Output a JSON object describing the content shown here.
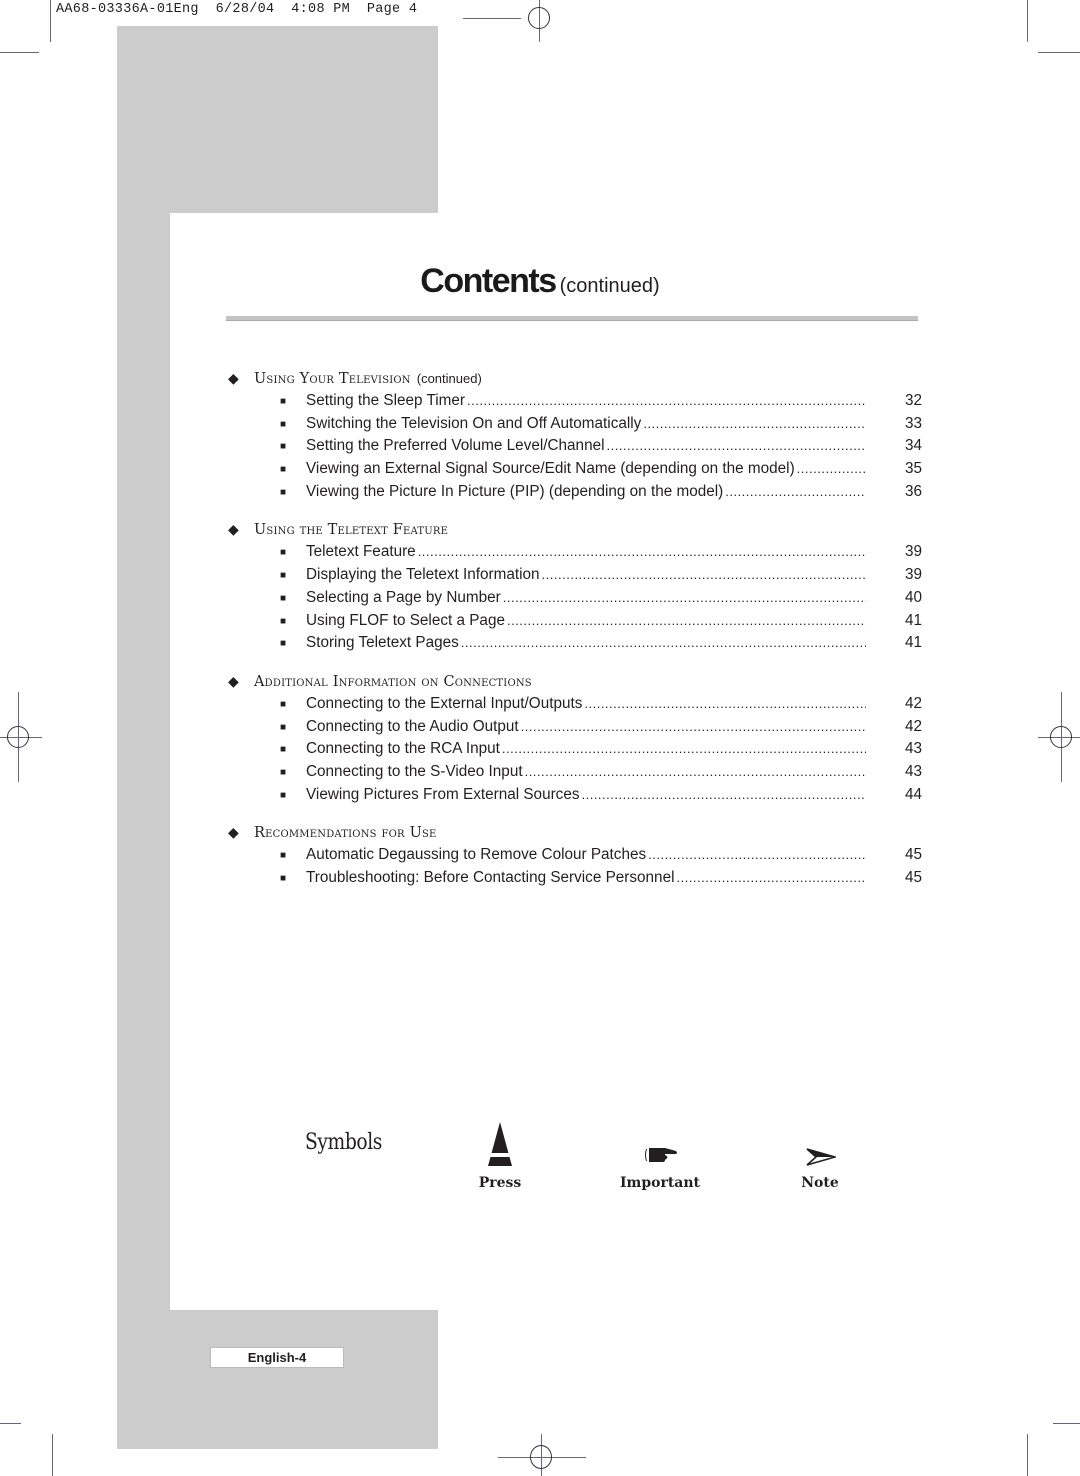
{
  "print_header": "AA68-03336A-01Eng  6/28/04  4:08 PM  Page 4",
  "title": {
    "main": "Contents",
    "sub": "(continued)"
  },
  "sections": [
    {
      "title": "Using Your Television",
      "note": "(continued)",
      "items": [
        {
          "text": "Setting the Sleep Timer",
          "page": "32"
        },
        {
          "text": "Switching the Television On and Off Automatically",
          "page": "33"
        },
        {
          "text": "Setting the Preferred Volume Level/Channel",
          "page": "34"
        },
        {
          "text": "Viewing an External Signal Source/Edit Name (depending on the model)",
          "page": "35"
        },
        {
          "text": "Viewing the Picture In Picture (PIP) (depending on the model)",
          "page": "36"
        }
      ]
    },
    {
      "title": "Using the Teletext Feature",
      "note": "",
      "items": [
        {
          "text": "Teletext Feature",
          "page": "39"
        },
        {
          "text": "Displaying the Teletext Information",
          "page": "39"
        },
        {
          "text": "Selecting a Page by Number",
          "page": "40"
        },
        {
          "text": "Using FLOF to Select a Page",
          "page": "41"
        },
        {
          "text": "Storing Teletext Pages",
          "page": "41"
        }
      ]
    },
    {
      "title": "Additional Information on Connections",
      "note": "",
      "items": [
        {
          "text": "Connecting to the External Input/Outputs",
          "page": "42"
        },
        {
          "text": "Connecting to the Audio Output",
          "page": "42"
        },
        {
          "text": "Connecting to the RCA Input",
          "page": "43"
        },
        {
          "text": "Connecting to the S-Video Input",
          "page": "43"
        },
        {
          "text": "Viewing Pictures From External Sources",
          "page": "44"
        }
      ]
    },
    {
      "title": "Recommendations for Use",
      "note": "",
      "items": [
        {
          "text": "Automatic Degaussing to Remove Colour Patches",
          "page": "45"
        },
        {
          "text": "Troubleshooting: Before Contacting Service Personnel",
          "page": "45"
        }
      ]
    }
  ],
  "symbols": {
    "title": "Symbols",
    "press": {
      "label": "Press",
      "icon": "press-triangle-icon"
    },
    "important": {
      "label": "Important",
      "icon": "pointing-hand-icon"
    },
    "note": {
      "label": "Note",
      "icon": "arrowhead-icon"
    }
  },
  "footer": {
    "page_label": "English-4"
  },
  "glyphs": {
    "section_marker": "◆",
    "item_bullet": "■"
  }
}
